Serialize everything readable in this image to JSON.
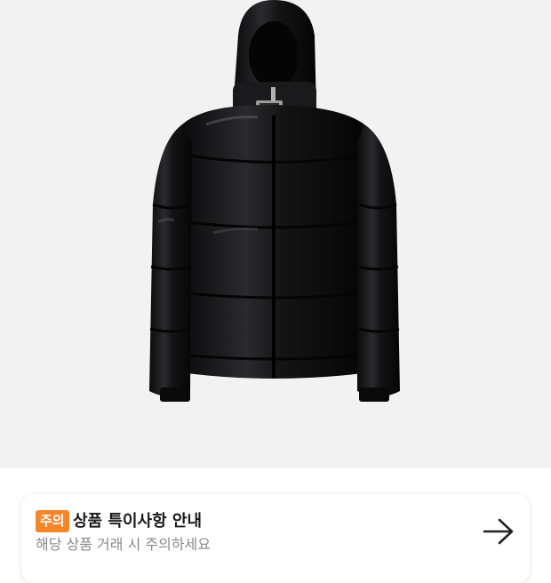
{
  "product": {
    "image_icon": "black-puffer-jacket-image",
    "background_color": "#f2f2f2"
  },
  "notice": {
    "badge": "주의",
    "title": "상품 특이사항 안내",
    "subtitle": "해당 상품 거래 시 주의하세요",
    "badge_color": "#f7862a",
    "action_icon": "arrow-right-icon"
  }
}
